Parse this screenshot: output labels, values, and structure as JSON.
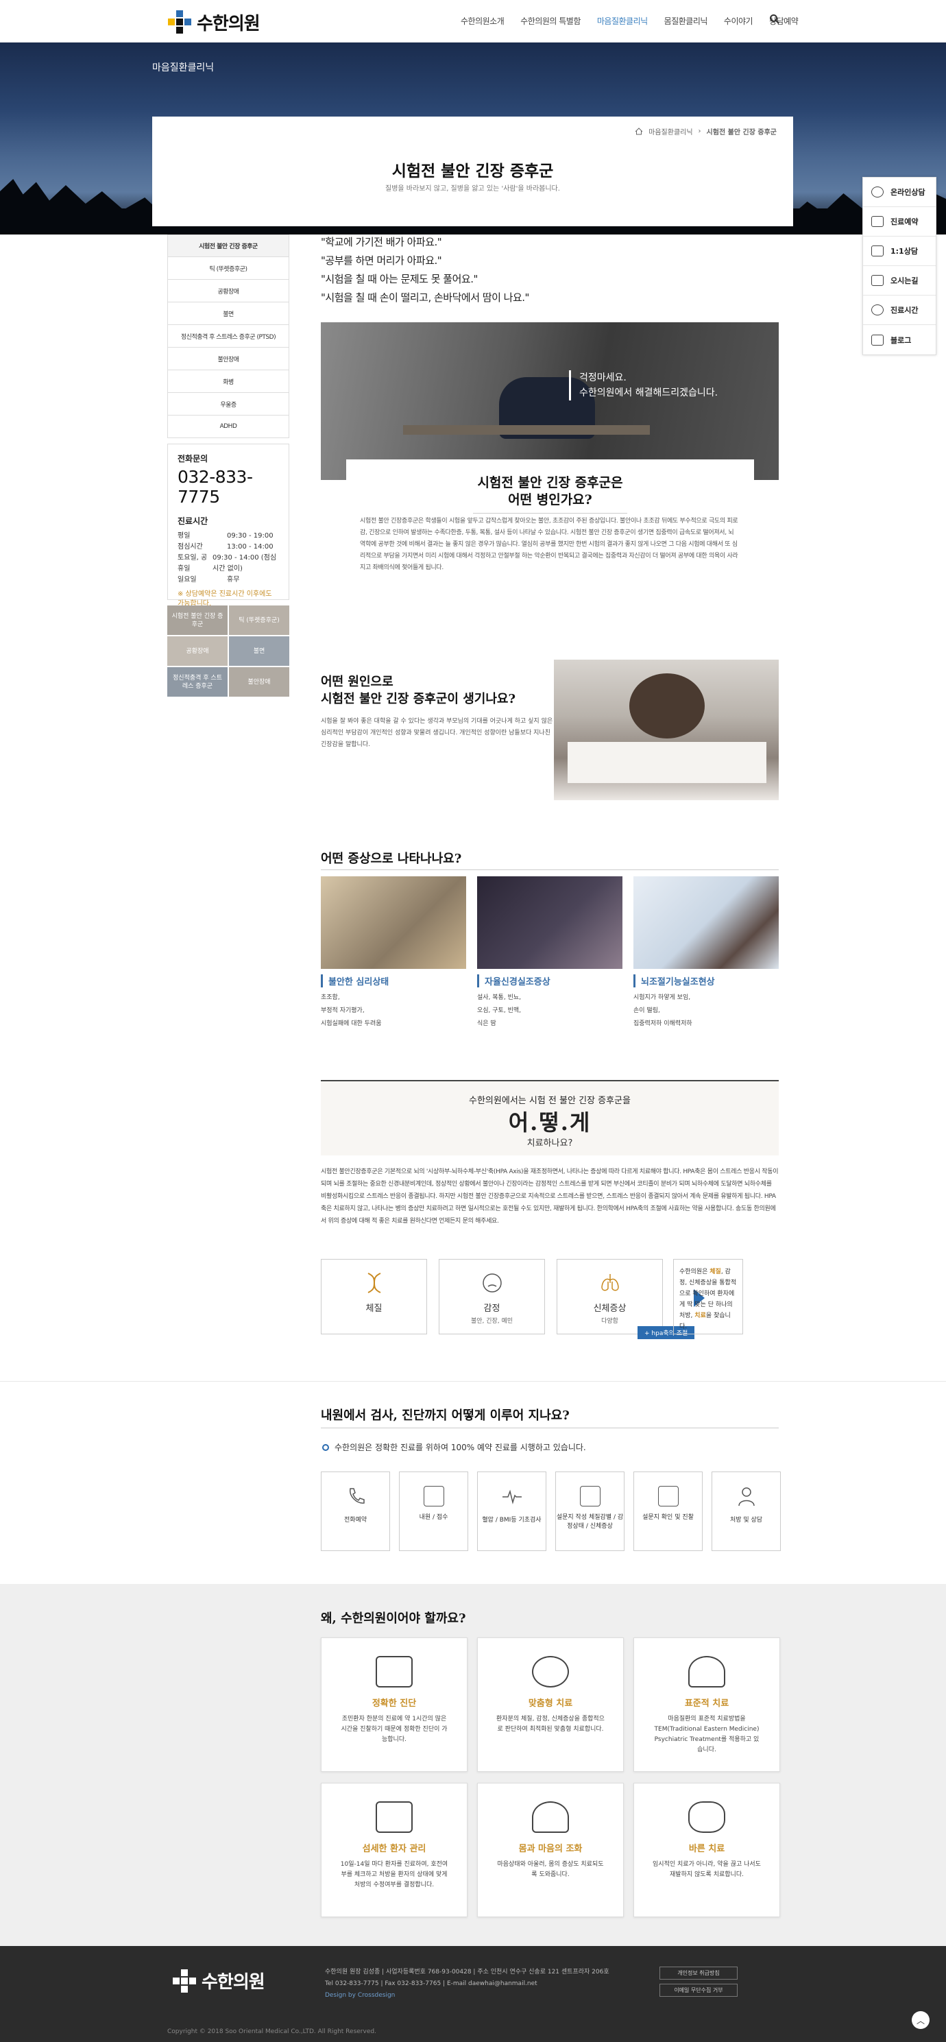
{
  "header": {
    "logo": "수한의원",
    "nav": [
      "수한의원소개",
      "수한의원의 특별함",
      "마음질환클리닉",
      "몸질환클리닉",
      "수이야기",
      "상담예약"
    ],
    "active_nav": 2
  },
  "hero": {
    "section_title": "마음질환클리닉"
  },
  "breadcrumb": [
    "마음질환클리닉",
    "시험전 불안 긴장 증후군"
  ],
  "page": {
    "title": "시험전 불안 긴장 증후군",
    "subtitle": "질병을 바라보지 않고, 질병을 앓고 있는 '사람'을 바라봅니다."
  },
  "quick_menu": [
    "온라인상담",
    "진료예약",
    "1:1상담",
    "오시는길",
    "진료시간",
    "블로그"
  ],
  "sidebar": {
    "items": [
      "시험전 불안 긴장 증후군",
      "틱 (뚜렛증후군)",
      "공황장애",
      "불면",
      "정신적충격 후 스트레스 증후군 (PTSD)",
      "불안장애",
      "화병",
      "우울증",
      "ADHD"
    ],
    "contact_label": "전화문의",
    "phone": "032-833-7775",
    "hours_title": "진료시간",
    "hours": [
      [
        "평일",
        "09:30 - 19:00"
      ],
      [
        "점심시간",
        "13:00 - 14:00"
      ],
      [
        "토요일, 공휴일",
        "09:30 - 14:00 (점심시간 없이)"
      ],
      [
        "일요일",
        "휴무"
      ]
    ],
    "note": "※ 상담예약은 진료시간 이후에도 가능합니다.",
    "mini": [
      "시험전 불안 긴장 증후군",
      "틱 (뚜렛증후군)",
      "공황장애",
      "불면",
      "정신적충격 후 스트레스 증후군",
      "불안장애"
    ]
  },
  "quotes": [
    "\"학교에 가기전 배가 아파요.\"",
    "\"공부를 하면 머리가 아파요.\"",
    "\"시험을 칠 때 아는 문제도 못 풀어요.\"",
    "\"시험을 칠 때 손이 떨리고, 손바닥에서 땀이 나요.\""
  ],
  "photo1_text": [
    "걱정마세요.",
    "수한의원에서 해결해드리겠습니다."
  ],
  "what": {
    "title": [
      "시험전 불안 긴장 증후군은",
      "어떤 병인가요?"
    ],
    "text": "시험전 불안 긴장증후군은 학생들이 시험을 앞두고 갑작스럽게 찾아오는 불안, 초조감이 주된 증상입니다. 불안이나 초조감 뒤에도 부수적으로 극도의 피로감, 긴장으로 인하여 발생하는 수족다한증, 두통, 복통, 설사 등이 나타날 수 있습니다. 시험전 불안 긴장 증후군이 생기면 집중력이 급속도로 떨어져서, 뇌 역학에 공부한 것에 비해서 결과는 늘 좋지 않은 경우가 많습니다. 열심히 공부를 했지만 한번 시험의 결과가 좋지 않게 나오면 그 다음 시험에 대해서 또 심리적으로 부담을 가지면서 미리 시험에 대해서 걱정하고 안절부절 하는 악순환이 반복되고 결국에는 집중력과 자신감이 더 떨어져 공부에 대한 의욕이 사라지고 좌배의식에 젖어들게 됩니다."
  },
  "cause": {
    "title": [
      "어떤 원인으로",
      "시험전 불안 긴장 증후군이 생기나요?"
    ],
    "text": "시험을 잘 봐야 좋은 대학을 갈 수 있다는 생각과 부모님의 기대를 어긋나게 하고 싶지 않은 심리적인 부담감이 개인적인 성향과 맞물려 생깁니다. 개인적인 성향이란 남들보다 지나친 긴장감을 말합니다."
  },
  "symptoms": {
    "title": "어떤 증상으로 나타나나요?",
    "items": [
      {
        "title": "불안한 심리상태",
        "lines": [
          "초조함,",
          "부정적 자기평가,",
          "시험실패에 대한 두려움"
        ]
      },
      {
        "title": "자율신경실조증상",
        "lines": [
          "설사, 복통, 빈뇨,",
          "오심, 구토, 빈맥,",
          "식은 땀"
        ]
      },
      {
        "title": "뇌조절기능실조현상",
        "lines": [
          "시험지가 하얗게 보임,",
          "손이 떨림,",
          "집중력저하 이해력저하"
        ]
      }
    ]
  },
  "treat": {
    "line1": "수한의원에서는 시험 전 불안 긴장 증후군을",
    "line2": "어.떻.게",
    "line3": "치료하나요?",
    "text": "시험전 불안긴장증후군은 기본적으로 뇌의 '시상하부-뇌하수체-부신'축(HPA Axis)을 재조정하면서, 나타나는 증상에 따라 다르게 치료해야 합니다. HPA축은 몸이 스트레스 반응시 작동이 되며 뇌를 조절하는 중요한 신경내분비계인데, 정상적인 상황에서 불안이나 긴장이라는 감정적인 스트레스를 받게 되면 부신에서 코티졸이 분비가 되며 뇌하수체에 도달하면 뇌하수체를 비활성화시킴으로 스트레스 반응이 종결됩니다. 하지만 시험전 불안 긴장증후군으로 지속적으로 스트레스를 받으면, 스트레스 반응이 종결되지 않아서 계속 문제를 유발하게 됩니다. HPA축은 치료하지 않고, 나타나는 병의 증상만 치료하려고 하면 일시적으로는 호전될 수도 있지만, 재발하게 됩니다. 한의학에서 HPA축의 조절에 사효하는 약을 사용합니다. 송도동 한의원에서 위의 증상에 대해 적 좋은 치료를 원하신다면 언제든지 문의 해주세요.",
    "cards": [
      {
        "t": "체질",
        "s": ""
      },
      {
        "t": "감정",
        "s": "불안, 긴장, 예민"
      },
      {
        "t": "신체증상",
        "s": "다양함"
      }
    ],
    "hpa": "+ hpa축의 조절",
    "result": [
      "수한의원은 ",
      "체질",
      ", 감정, 신체증상을 통합적으로 확인하여 환자에게 딱 맞는 단 하나의 처방, ",
      "치료",
      "을 찾습니다."
    ]
  },
  "process": {
    "title": "내원에서 검사, 진단까지 어떻게 이루어 지나요?",
    "sub": "수한의원은 정확한 진료를 위하여 100% 예약 진료를 시행하고 있습니다.",
    "steps": [
      "전화예약",
      "내원 / 접수",
      "혈압 / BMI등 기초검사",
      "설문지 작성 체질감별 / 감정상태 / 신체증상",
      "설문지 확인 및 진찰",
      "처방 및 상담"
    ]
  },
  "why": {
    "title": "왜, 수한의원이어야 할까요?",
    "items": [
      {
        "t": "정확한 진단",
        "d": "조민환자 한분의 진료에 약 1시간의 많은 시간을 진찰하기 때문에 정확한 진단이 가능합니다."
      },
      {
        "t": "맞춤형 치료",
        "d": "환자분의 체질, 감정, 신체증상을 종합적으로 판단하여 최적화된 맞춤형 치료합니다."
      },
      {
        "t": "표준적 치료",
        "d": "마음질환의 표준적 치료방법을 TEM(Traditional Eastern Medicine) Psychiatric Treatment를 적용하고 있습니다."
      },
      {
        "t": "섬세한 환자 관리",
        "d": "10일-14일 마다 환자를 진료하여, 호전여부를 체크하고 처방을 환자의 상태에 맞게 처방의 수정여부를 결정합니다."
      },
      {
        "t": "몸과 마음의 조화",
        "d": "마음상태와 아울러, 몸의 증상도 치료되도록 도와줍니다."
      },
      {
        "t": "바른 치료",
        "d": "임시적인 치료가 아니라, 약을 끊고 나서도 재발하지 않도록 치료합니다."
      }
    ]
  },
  "footer": {
    "logo": "수한의원",
    "line1": "수한의원 원장 김성종 | 사업자등록번호 768-93-00428 | 주소 인천시 연수구 신송로 121 센트프라자 206호",
    "line2": "Tel 032-833-7775 | Fax 032-833-7765 | E-mail daewhai@hanmail.net",
    "design": "Design by Crossdesign",
    "btn1": "개인정보 취급방침",
    "btn2": "이메일 무단수집 거부",
    "copy": "Copyright © 2018 Soo Oriental Medical Co.,LTD. All Right Reserved."
  },
  "colors": {
    "accent": "#3a7fbf",
    "gold": "#c8902a",
    "dark": "#2c2c2c"
  }
}
